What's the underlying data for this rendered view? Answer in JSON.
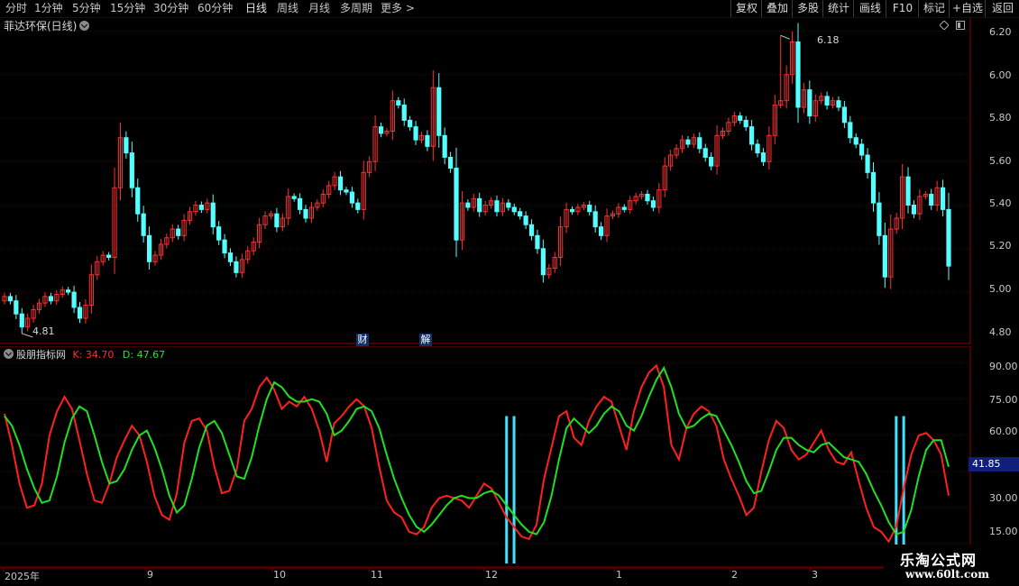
{
  "toolbar": {
    "periods": [
      "分时",
      "1分钟",
      "5分钟",
      "15分钟",
      "30分钟",
      "60分钟",
      "日线",
      "周线",
      "月线",
      "多周期",
      "更多 >"
    ],
    "active_period": "日线",
    "right_buttons": [
      "复权",
      "叠加",
      "多股",
      "统计",
      "画线",
      "F10",
      "标记",
      "+自选",
      "返回"
    ]
  },
  "main_chart": {
    "title": "菲达环保(日线)",
    "high_label": "6.18",
    "low_label": "4.81",
    "y_ticks": [
      "6.20",
      "6.00",
      "5.80",
      "5.60",
      "5.40",
      "5.20",
      "5.00",
      "4.80"
    ],
    "badges": [
      "财",
      "解"
    ],
    "colors": {
      "up": "#ff3030",
      "down": "#54ffff",
      "grid": "#5a0000",
      "frame": "#8b0000"
    }
  },
  "indicator": {
    "name": "股朋指标网",
    "k_label": "K: 34.70",
    "d_label": "D: 47.67",
    "y_ticks": [
      "90.00",
      "75.00",
      "60.00",
      "45.00",
      "30.00",
      "15.00"
    ],
    "current_value": "41.85",
    "colors": {
      "k": "#ff2020",
      "d": "#20e020",
      "signal": "#40e0ff"
    }
  },
  "date_axis": {
    "labels": [
      "2025年",
      "9",
      "10",
      "11",
      "12",
      "1",
      "2",
      "3"
    ]
  },
  "watermark": {
    "line1": "乐淘公式网",
    "line2": "www.60lt.com"
  },
  "chart_data": [
    {
      "type": "candlestick",
      "title": "菲达环保(日线)",
      "ylim": [
        4.76,
        6.26
      ],
      "y_ticks": [
        6.2,
        6.0,
        5.8,
        5.6,
        5.4,
        5.2,
        5.0,
        4.8
      ],
      "x_labels": [
        "2025年",
        "9",
        "10",
        "11",
        "12",
        "1",
        "2",
        "3"
      ],
      "closes": [
        4.98,
        4.96,
        4.9,
        4.84,
        4.88,
        4.92,
        4.95,
        4.98,
        4.96,
        4.99,
        5.01,
        5.0,
        4.93,
        4.88,
        4.94,
        5.08,
        5.14,
        5.17,
        5.16,
        5.48,
        5.71,
        5.64,
        5.48,
        5.36,
        5.26,
        5.14,
        5.17,
        5.22,
        5.25,
        5.29,
        5.26,
        5.33,
        5.37,
        5.4,
        5.38,
        5.41,
        5.3,
        5.24,
        5.18,
        5.14,
        5.09,
        5.15,
        5.19,
        5.23,
        5.31,
        5.35,
        5.36,
        5.3,
        5.34,
        5.44,
        5.43,
        5.38,
        5.34,
        5.39,
        5.41,
        5.45,
        5.49,
        5.53,
        5.47,
        5.46,
        5.41,
        5.38,
        5.55,
        5.6,
        5.76,
        5.73,
        5.74,
        5.88,
        5.86,
        5.79,
        5.76,
        5.7,
        5.72,
        5.67,
        5.94,
        5.72,
        5.62,
        5.57,
        5.24,
        5.41,
        5.39,
        5.43,
        5.37,
        5.4,
        5.42,
        5.37,
        5.41,
        5.39,
        5.37,
        5.35,
        5.31,
        5.26,
        5.2,
        5.08,
        5.11,
        5.16,
        5.3,
        5.38,
        5.37,
        5.39,
        5.4,
        5.37,
        5.3,
        5.26,
        5.35,
        5.36,
        5.39,
        5.38,
        5.42,
        5.44,
        5.45,
        5.42,
        5.39,
        5.47,
        5.58,
        5.63,
        5.66,
        5.7,
        5.68,
        5.71,
        5.66,
        5.62,
        5.58,
        5.72,
        5.74,
        5.78,
        5.81,
        5.79,
        5.76,
        5.68,
        5.64,
        5.6,
        5.72,
        5.86,
        5.88,
        6.0,
        6.15,
        5.85,
        5.93,
        5.81,
        5.88,
        5.9,
        5.86,
        5.88,
        5.85,
        5.78,
        5.71,
        5.68,
        5.63,
        5.55,
        5.41,
        5.26,
        5.07,
        5.29,
        5.34,
        5.53,
        5.4,
        5.36,
        5.44,
        5.45,
        5.4,
        5.48,
        5.38,
        5.12
      ],
      "high": 6.18,
      "low": 4.81
    },
    {
      "type": "line",
      "title": "股朋指标网",
      "ylim": [
        5,
        97
      ],
      "y_ticks": [
        90,
        75,
        60,
        45,
        30,
        15
      ],
      "series": [
        {
          "name": "K",
          "values": [
            69,
            56,
            40,
            30,
            31,
            40,
            60,
            70,
            76,
            71,
            58,
            44,
            33,
            32,
            40,
            51,
            58,
            64,
            60,
            49,
            35,
            27,
            25,
            36,
            57,
            66,
            67,
            62,
            47,
            36,
            37,
            46,
            66,
            71,
            80,
            84,
            79,
            71,
            74,
            72,
            76,
            71,
            62,
            49,
            65,
            68,
            72,
            75,
            72,
            63,
            47,
            33,
            28,
            26,
            20,
            19,
            22,
            30,
            34,
            35,
            34,
            33,
            30,
            35,
            40,
            38,
            32,
            26,
            22,
            18,
            17,
            23,
            42,
            55,
            68,
            70,
            59,
            56,
            66,
            72,
            76,
            74,
            64,
            54,
            70,
            80,
            86,
            89,
            80,
            56,
            50,
            63,
            69,
            72,
            70,
            64,
            50,
            42,
            35,
            27,
            30,
            45,
            58,
            66,
            63,
            54,
            50,
            52,
            57,
            62,
            54,
            49,
            48,
            53,
            41,
            30,
            22,
            20,
            16,
            22,
            38,
            52,
            60,
            61,
            58,
            52,
            35
          ]
        },
        {
          "name": "D",
          "values": [
            68,
            64,
            56,
            46,
            38,
            32,
            33,
            43,
            57,
            67,
            72,
            70,
            60,
            49,
            40,
            41,
            46,
            54,
            60,
            62,
            55,
            46,
            35,
            28,
            31,
            42,
            55,
            64,
            66,
            61,
            52,
            43,
            42,
            51,
            64,
            75,
            82,
            80,
            76,
            74,
            74,
            75,
            74,
            69,
            60,
            62,
            66,
            71,
            72,
            70,
            63,
            52,
            42,
            34,
            27,
            22,
            20,
            23,
            27,
            31,
            34,
            35,
            34,
            34,
            36,
            37,
            35,
            31,
            27,
            23,
            20,
            19,
            24,
            35,
            50,
            63,
            67,
            64,
            61,
            64,
            69,
            72,
            70,
            64,
            62,
            68,
            76,
            83,
            88,
            80,
            69,
            63,
            64,
            67,
            69,
            68,
            62,
            56,
            49,
            41,
            36,
            37,
            45,
            54,
            59,
            59,
            56,
            54,
            53,
            56,
            57,
            54,
            51,
            50,
            49,
            44,
            37,
            31,
            24,
            19,
            20,
            29,
            43,
            54,
            58,
            58,
            47
          ]
        }
      ],
      "signal_bars": [
        {
          "at_index": 67,
          "kind": "signal"
        },
        {
          "at_index": 68,
          "kind": "signal"
        },
        {
          "at_index": 119,
          "kind": "signal"
        },
        {
          "at_index": 120,
          "kind": "signal"
        }
      ]
    }
  ]
}
